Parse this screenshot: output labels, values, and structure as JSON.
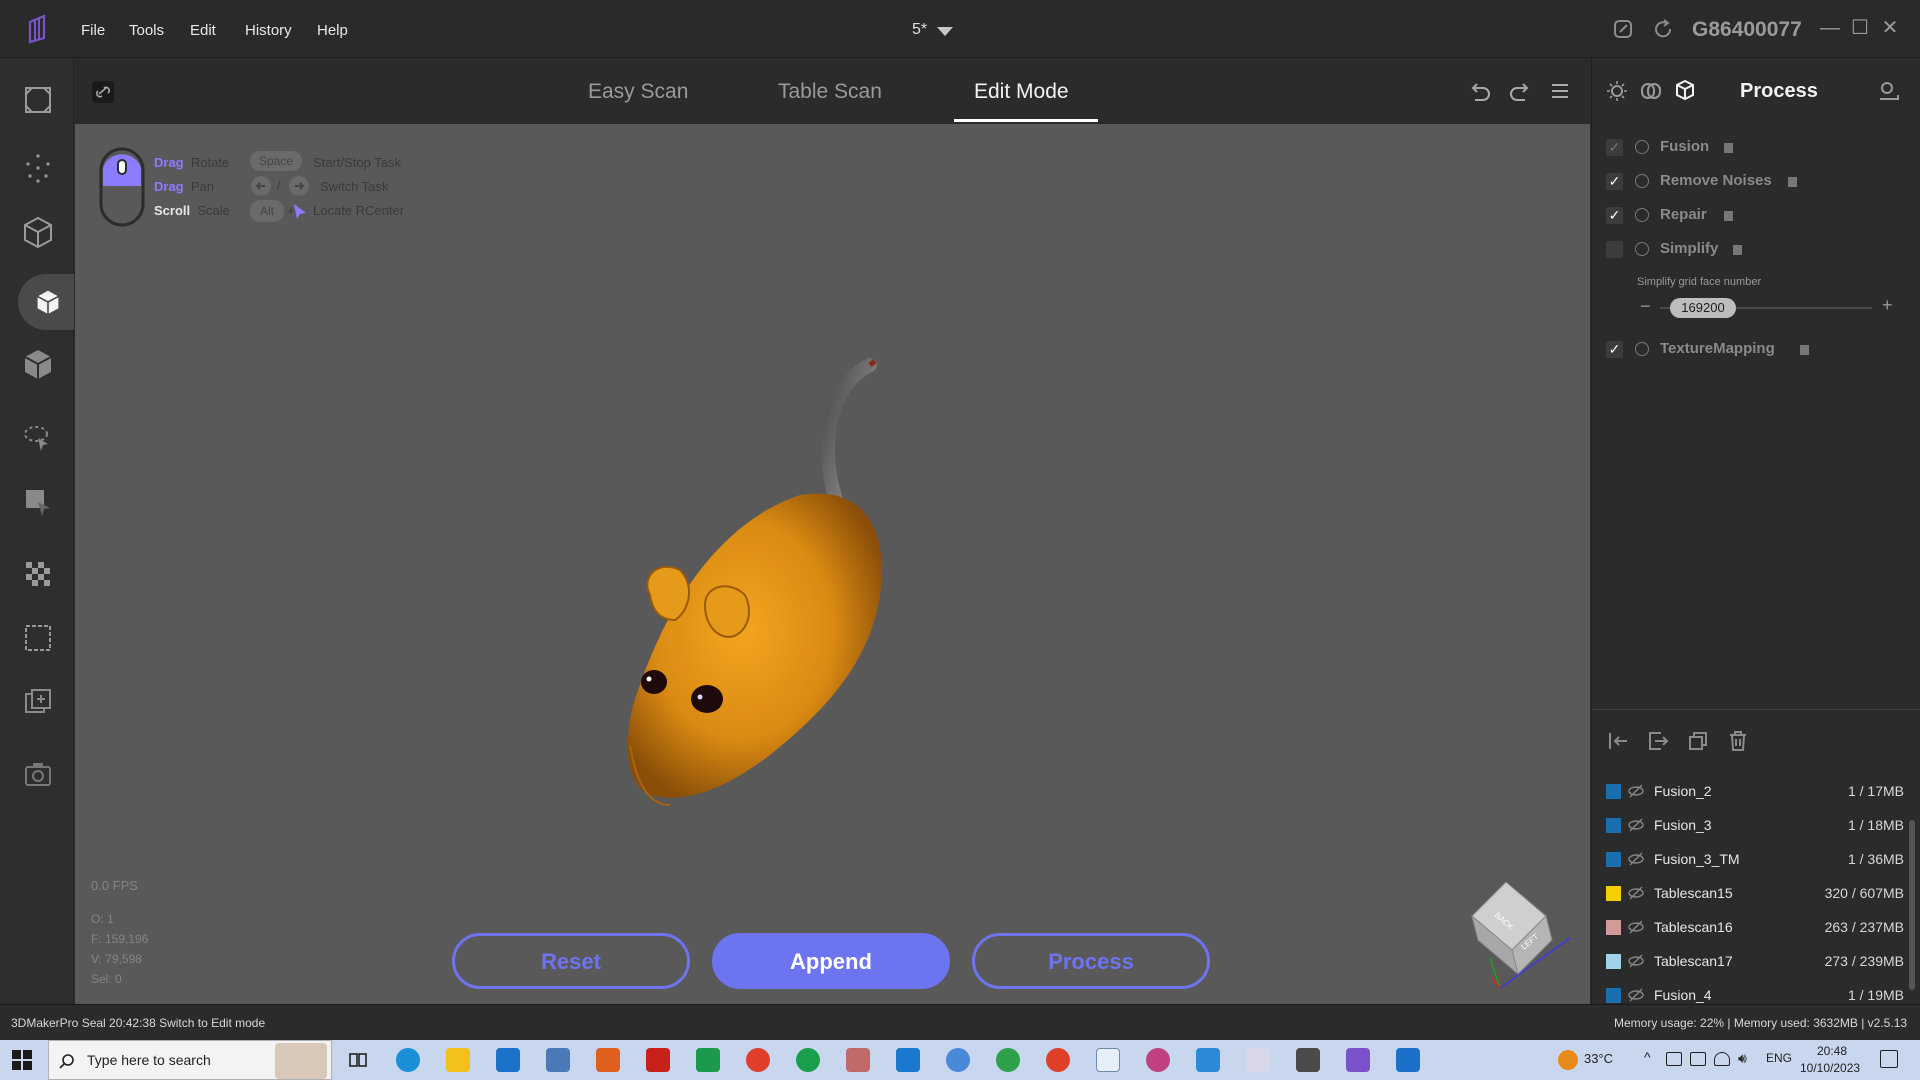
{
  "menu": {
    "file": "File",
    "tools": "Tools",
    "edit": "Edit",
    "history": "History",
    "help": "Help"
  },
  "project": {
    "name": "5*"
  },
  "device": {
    "id": "G86400077"
  },
  "mode_tabs": [
    {
      "label": "Easy Scan",
      "active": false
    },
    {
      "label": "Table Scan",
      "active": false
    },
    {
      "label": "Edit Mode",
      "active": true
    }
  ],
  "hints": {
    "drag1": "Drag",
    "rotate": "Rotate",
    "drag2": "Drag",
    "pan": "Pan",
    "scroll": "Scroll",
    "scale": "Scale",
    "space_key": "Space",
    "start_stop": "Start/Stop Task",
    "slash": "/",
    "switch_task": "Switch Task",
    "alt_key": "Alt",
    "plus": "+",
    "locate": "Locate RCenter"
  },
  "stats": {
    "fps": "0.0 FPS",
    "o": "O: 1",
    "f": "F: 159,196",
    "v": "V: 79,598",
    "sel": "Sel: 0"
  },
  "actions": {
    "reset": "Reset",
    "append": "Append",
    "process": "Process"
  },
  "panel": {
    "title": "Process",
    "steps": [
      {
        "label": "Fusion",
        "checked": true,
        "disabled": true
      },
      {
        "label": "Remove Noises",
        "checked": true
      },
      {
        "label": "Repair",
        "checked": true
      },
      {
        "label": "Simplify",
        "checked": false
      },
      {
        "label": "TextureMapping",
        "checked": true
      }
    ],
    "simplify_label": "Simplify grid face number",
    "simplify_value": "169200",
    "minus": "−",
    "plus": "+"
  },
  "models": [
    {
      "name": "Fusion_2",
      "size": "1 / 17MB",
      "color": "#1a6fb0"
    },
    {
      "name": "Fusion_3",
      "size": "1 / 18MB",
      "color": "#1a6fb0"
    },
    {
      "name": "Fusion_3_TM",
      "size": "1 / 36MB",
      "color": "#1a6fb0"
    },
    {
      "name": "Tablescan15",
      "size": "320 / 607MB",
      "color": "#f5d000"
    },
    {
      "name": "Tablescan16",
      "size": "263 / 237MB",
      "color": "#d39a9a"
    },
    {
      "name": "Tablescan17",
      "size": "273 / 239MB",
      "color": "#9fd3ea"
    },
    {
      "name": "Fusion_4",
      "size": "1 / 19MB",
      "color": "#1a6fb0"
    }
  ],
  "status": {
    "left": "3DMakerPro Seal   20:42:38 Switch to Edit mode",
    "right": "Memory usage: 22% | Memory used: 3632MB | v2.5.13"
  },
  "taskbar": {
    "search_placeholder": "Type here to search",
    "temp": "33°C",
    "lang": "ENG",
    "time": "20:48",
    "date": "10/10/2023"
  },
  "view_cube": {
    "back": "BACK",
    "left": "LEFT"
  },
  "colors": {
    "accent": "#6d74f0",
    "viewport": "#595959"
  }
}
